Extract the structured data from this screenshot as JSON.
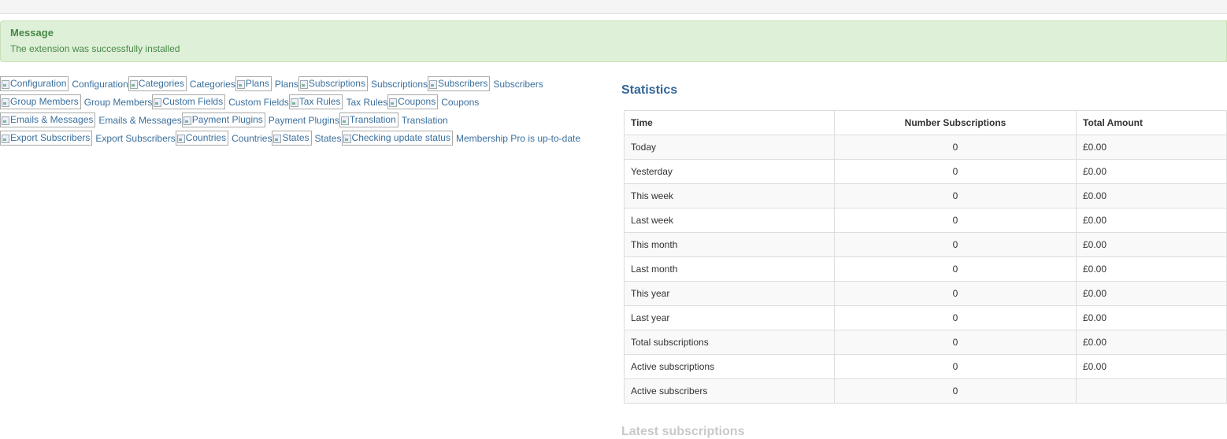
{
  "alert": {
    "heading": "Message",
    "text": "The extension was successfully installed",
    "color": "#dff0d8"
  },
  "icons": {
    "rows": [
      [
        {
          "alt": "Configuration",
          "label": "Configuration"
        },
        {
          "alt": "Categories",
          "label": "Categories"
        },
        {
          "alt": "Plans",
          "label": "Plans"
        },
        {
          "alt": "Subscriptions",
          "label": "Subscriptions"
        },
        {
          "alt": "Subscribers",
          "label": "Subscribers"
        }
      ],
      [
        {
          "alt": "Group Members",
          "label": "Group Members"
        },
        {
          "alt": "Custom Fields",
          "label": "Custom Fields"
        },
        {
          "alt": "Tax Rules",
          "label": "Tax Rules"
        },
        {
          "alt": "Coupons",
          "label": "Coupons"
        }
      ],
      [
        {
          "alt": "Emails & Messages",
          "label": "Emails & Messages"
        },
        {
          "alt": "Payment Plugins",
          "label": "Payment Plugins"
        },
        {
          "alt": "Translation",
          "label": "Translation"
        }
      ],
      [
        {
          "alt": "Export Subscribers",
          "label": "Export Subscribers"
        },
        {
          "alt": "Countries",
          "label": "Countries"
        },
        {
          "alt": "States",
          "label": "States"
        },
        {
          "alt": "Checking update status",
          "label": "Membership Pro is up-to-date"
        }
      ]
    ]
  },
  "stats": {
    "title": "Statistics",
    "columns": [
      "Time",
      "Number Subscriptions",
      "Total Amount"
    ],
    "rows": [
      [
        "Today",
        "0",
        "£0.00"
      ],
      [
        "Yesterday",
        "0",
        "£0.00"
      ],
      [
        "This week",
        "0",
        "£0.00"
      ],
      [
        "Last week",
        "0",
        "£0.00"
      ],
      [
        "This month",
        "0",
        "£0.00"
      ],
      [
        "Last month",
        "0",
        "£0.00"
      ],
      [
        "This year",
        "0",
        "£0.00"
      ],
      [
        "Last year",
        "0",
        "£0.00"
      ],
      [
        "Total subscriptions",
        "0",
        "£0.00"
      ],
      [
        "Active subscriptions",
        "0",
        "£0.00"
      ],
      [
        "Active subscribers",
        "0",
        ""
      ]
    ]
  },
  "latest": {
    "title": "Latest subscriptions"
  }
}
